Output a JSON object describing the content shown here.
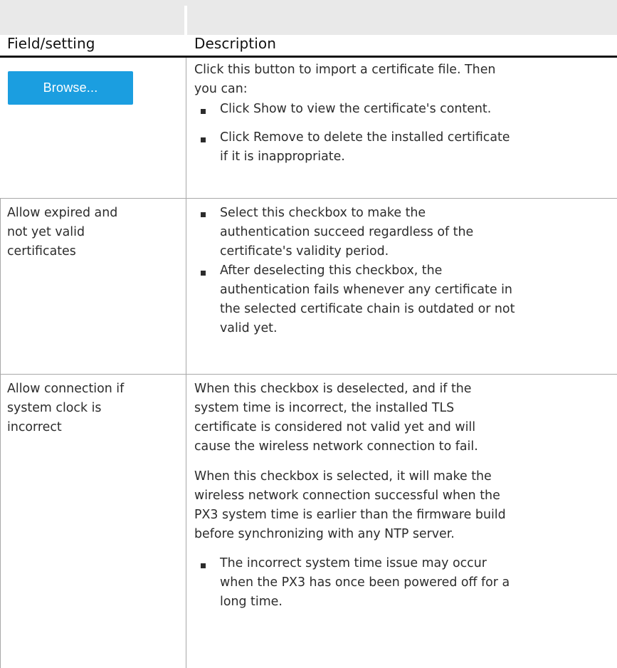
{
  "table": {
    "headers": {
      "field": "Field/setting",
      "description": "Description"
    },
    "browse_button": "Browse...",
    "row1": {
      "intro": [
        "Click this button to import a certificate file. Then",
        "you can:"
      ],
      "bullets": [
        [
          "Click Show to view the certificate's content."
        ],
        [
          "Click Remove to delete the installed certificate",
          "if it is inappropriate."
        ]
      ]
    },
    "row2": {
      "field": [
        "Allow expired and",
        "not yet valid",
        "certificates"
      ],
      "bullets": [
        [
          "Select this checkbox to make the",
          "authentication succeed regardless of the",
          "certificate's validity period."
        ],
        [
          "After deselecting this checkbox, the",
          "authentication fails whenever any certificate in",
          "the selected certificate chain is outdated or not",
          "valid yet."
        ]
      ]
    },
    "row3": {
      "field": [
        "Allow connection if",
        "system clock is",
        "incorrect"
      ],
      "para1": [
        "When this checkbox is deselected, and if the",
        "system time is incorrect, the installed TLS",
        "certificate is considered not valid yet and will",
        "cause the wireless network connection to fail."
      ],
      "para2": [
        "When this checkbox is selected, it will make the",
        "wireless network connection successful when the",
        "PX3 system time is earlier than the firmware build",
        "before synchronizing with any NTP server."
      ],
      "bullets": [
        [
          "The incorrect system time issue may occur",
          "when the PX3 has once been powered off for a",
          "long time."
        ]
      ]
    }
  }
}
